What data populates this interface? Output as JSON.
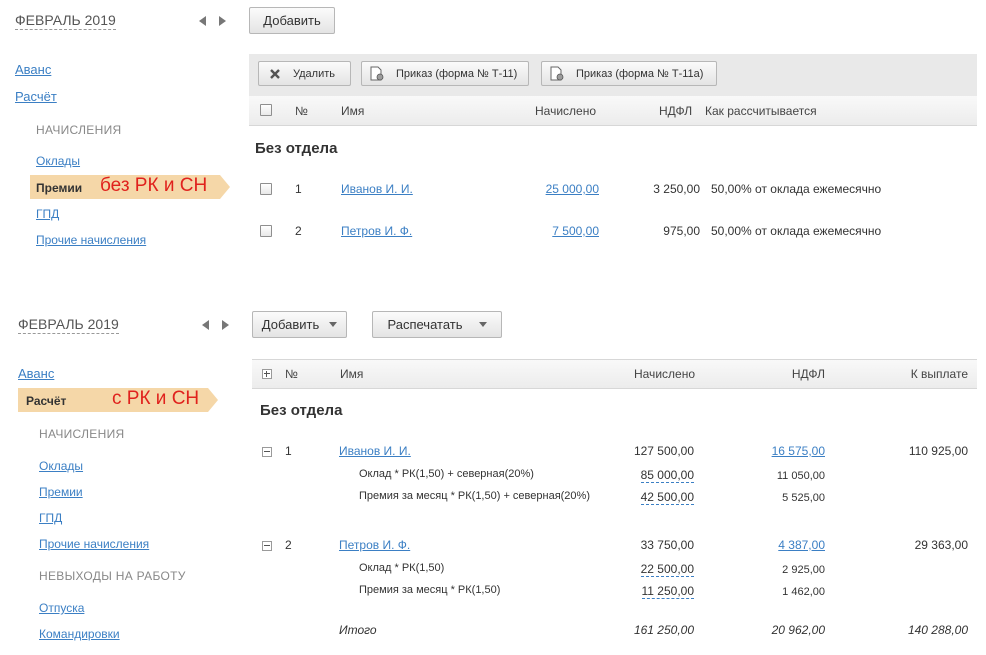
{
  "top": {
    "period": "ФЕВРАЛЬ 2019",
    "add_label": "Добавить",
    "nav": {
      "advance": "Аванс",
      "calc": "Расчёт"
    },
    "section": "НАЧИСЛЕНИЯ",
    "items": {
      "salaries": "Оклады",
      "bonuses": "Премии",
      "gpd": "ГПД",
      "other": "Прочие начисления"
    },
    "annotation": "без РК и СН",
    "toolbar": {
      "delete": "Удалить",
      "order_t11": "Приказ (форма № Т-11)",
      "order_t11a": "Приказ (форма № Т-11а)"
    },
    "columns": {
      "num": "№",
      "name": "Имя",
      "accrued": "Начислено",
      "ndfl": "НДФЛ",
      "how": "Как рассчитывается"
    },
    "group": "Без отдела",
    "rows": [
      {
        "num": "1",
        "name": "Иванов И. И.",
        "accrued": "25 000,00",
        "ndfl": "3 250,00",
        "how": "50,00% от оклада ежемесячно"
      },
      {
        "num": "2",
        "name": "Петров И. Ф.",
        "accrued": "7 500,00",
        "ndfl": "975,00",
        "how": "50,00% от оклада ежемесячно"
      }
    ]
  },
  "bottom": {
    "period": "ФЕВРАЛЬ 2019",
    "add_label": "Добавить",
    "print_label": "Распечатать",
    "nav": {
      "advance": "Аванс",
      "calc": "Расчёт"
    },
    "annotation": "с РК и СН",
    "section_accruals": "НАЧИСЛЕНИЯ",
    "items": {
      "salaries": "Оклады",
      "bonuses": "Премии",
      "gpd": "ГПД",
      "other": "Прочие начисления"
    },
    "section_absences": "НЕВЫХОДЫ НА РАБОТУ",
    "absences": {
      "vacations": "Отпуска",
      "trips": "Командировки"
    },
    "columns": {
      "num": "№",
      "name": "Имя",
      "accrued": "Начислено",
      "ndfl": "НДФЛ",
      "payout": "К выплате"
    },
    "group": "Без отдела",
    "employees": [
      {
        "num": "1",
        "name": "Иванов И. И.",
        "accrued": "127 500,00",
        "ndfl": "16 575,00",
        "payout": "110 925,00",
        "details": [
          {
            "label": "Оклад * РК(1,50) + северная(20%)",
            "accrued": "85 000,00",
            "ndfl": "11 050,00"
          },
          {
            "label": "Премия за месяц * РК(1,50) + северная(20%)",
            "accrued": "42 500,00",
            "ndfl": "5 525,00"
          }
        ]
      },
      {
        "num": "2",
        "name": "Петров И. Ф.",
        "accrued": "33 750,00",
        "ndfl": "4 387,00",
        "payout": "29 363,00",
        "details": [
          {
            "label": "Оклад * РК(1,50)",
            "accrued": "22 500,00",
            "ndfl": "2 925,00"
          },
          {
            "label": "Премия за месяц * РК(1,50)",
            "accrued": "11 250,00",
            "ndfl": "1 462,00"
          }
        ]
      }
    ],
    "total": {
      "label": "Итого",
      "accrued": "161 250,00",
      "ndfl": "20 962,00",
      "payout": "140 288,00"
    }
  }
}
